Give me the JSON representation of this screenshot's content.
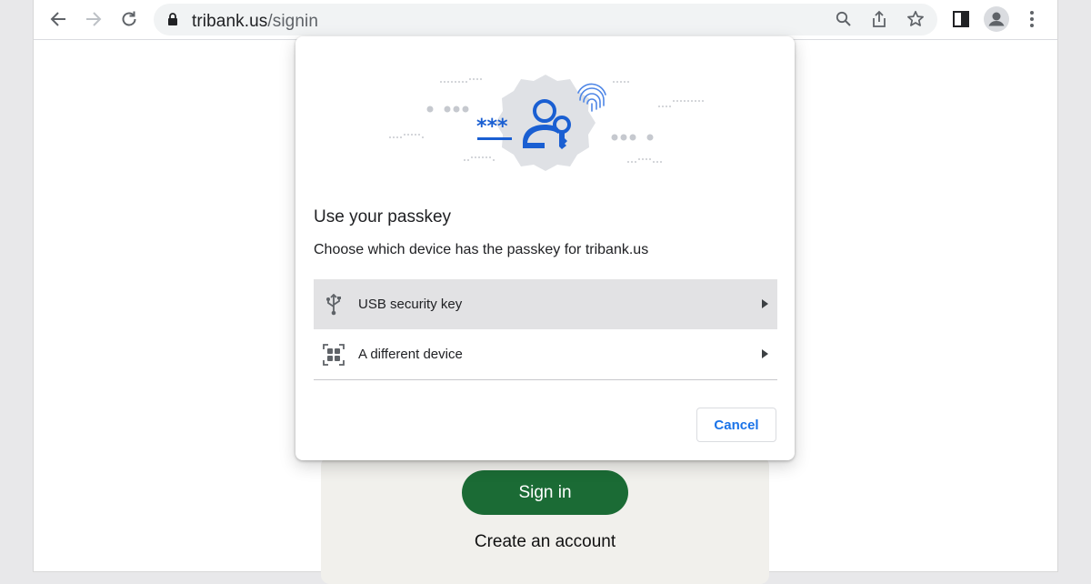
{
  "browser": {
    "url_host": "tribank.us",
    "url_path": "/signin",
    "icons": [
      "back-icon",
      "forward-icon",
      "reload-icon",
      "lock-icon",
      "zoom-icon",
      "share-icon",
      "bookmark-star-icon",
      "side-panel-icon",
      "profile-icon",
      "menu-icon"
    ]
  },
  "page": {
    "signin_button": "Sign in",
    "create_account": "Create an account"
  },
  "dialog": {
    "title": "Use your passkey",
    "subtitle": "Choose which device has the passkey for tribank.us",
    "options": [
      {
        "label": "USB security key",
        "icon": "usb-icon"
      },
      {
        "label": "A different device",
        "icon": "qr-code-icon"
      }
    ],
    "cancel": "Cancel"
  },
  "colors": {
    "accent": "#1a73e8",
    "illustration_blue": "#1a5fd2",
    "signin_green": "#1b6b35",
    "hover_gray": "#e2e2e4"
  }
}
